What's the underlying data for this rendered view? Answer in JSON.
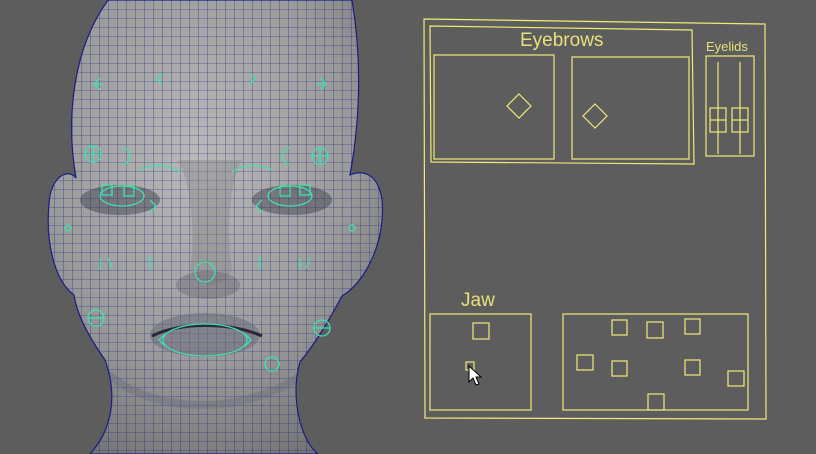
{
  "viewport": {
    "background": "#5d5d5d",
    "mesh_color": "#151880",
    "skin_color": "#a8a8a8",
    "control_color": "#3fe0b0",
    "picker_color": "#f2e97a"
  },
  "head_model": {
    "name": "face-mesh",
    "controls": "facial-rig-controls"
  },
  "picker": {
    "eyebrows_label": "Eyebrows",
    "eyelids_label": "Eyelids",
    "jaw_label": "Jaw"
  },
  "cursor": {
    "icon": "arrow-cursor-icon"
  }
}
